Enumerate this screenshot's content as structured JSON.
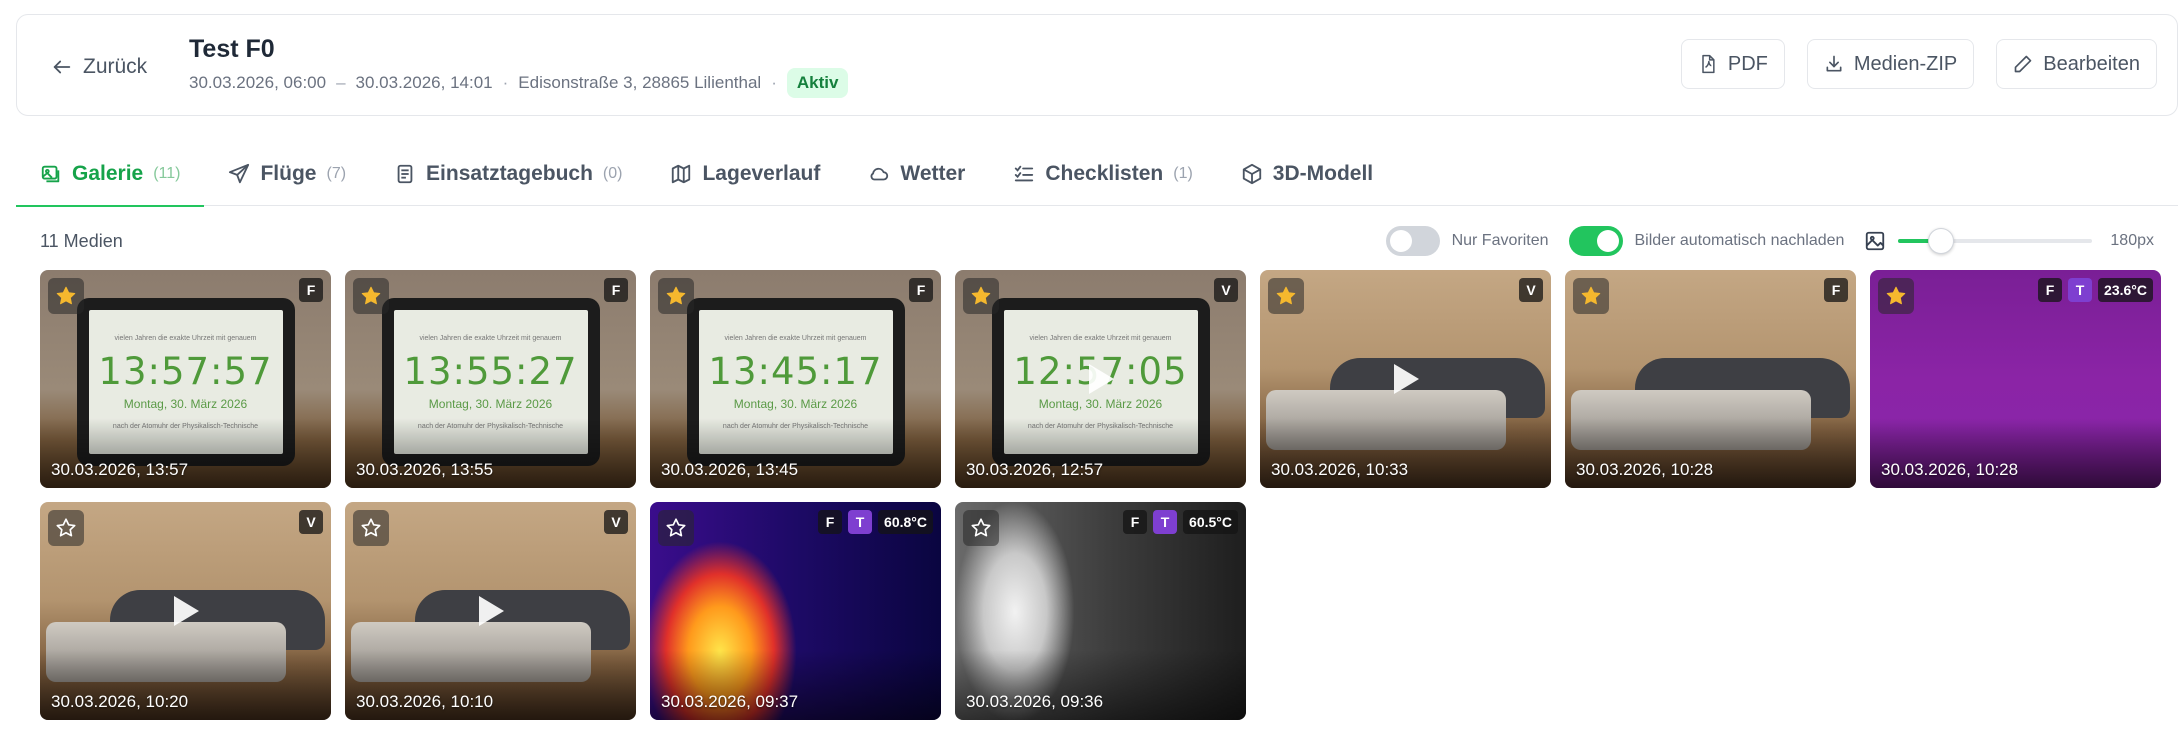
{
  "header": {
    "back_label": "Zurück",
    "title": "Test F0",
    "start": "30.03.2026, 06:00",
    "dash": "–",
    "end": "30.03.2026, 14:01",
    "dot": "·",
    "address": "Edisonstraße 3, 28865 Lilienthal",
    "status": "Aktiv",
    "buttons": {
      "pdf": "PDF",
      "zip": "Medien-ZIP",
      "edit": "Bearbeiten"
    }
  },
  "tabs": [
    {
      "label": "Galerie",
      "count": "(11)"
    },
    {
      "label": "Flüge",
      "count": "(7)"
    },
    {
      "label": "Einsatztagebuch",
      "count": "(0)"
    },
    {
      "label": "Lageverlauf",
      "count": ""
    },
    {
      "label": "Wetter",
      "count": ""
    },
    {
      "label": "Checklisten",
      "count": "(1)"
    },
    {
      "label": "3D-Modell",
      "count": ""
    }
  ],
  "toolbar": {
    "media_count": "11 Medien",
    "favorites_label": "Nur Favoriten",
    "autoreload_label": "Bilder automatisch nachladen",
    "size_label": "180px",
    "size_fraction": 0.22
  },
  "clock": {
    "top_line": "vielen Jahren die exakte Uhrzeit mit genauem",
    "date_line": "Montag, 30. März 2026",
    "bottom_line": "nach der Atomuhr der Physikalisch-Technische"
  },
  "media": [
    {
      "timestamp": "30.03.2026, 13:57",
      "favorite": true,
      "type": "F",
      "thermal": false,
      "temp": "",
      "clock": "13:57:57",
      "video": false,
      "scene": "clock"
    },
    {
      "timestamp": "30.03.2026, 13:55",
      "favorite": true,
      "type": "F",
      "thermal": false,
      "temp": "",
      "clock": "13:55:27",
      "video": false,
      "scene": "clock"
    },
    {
      "timestamp": "30.03.2026, 13:45",
      "favorite": true,
      "type": "F",
      "thermal": false,
      "temp": "",
      "clock": "13:45:17",
      "video": false,
      "scene": "clock"
    },
    {
      "timestamp": "30.03.2026, 12:57",
      "favorite": true,
      "type": "V",
      "thermal": false,
      "temp": "",
      "clock": "12:57:05",
      "video": true,
      "scene": "clock"
    },
    {
      "timestamp": "30.03.2026, 10:33",
      "favorite": true,
      "type": "V",
      "thermal": false,
      "temp": "",
      "clock": "",
      "video": true,
      "scene": "desk"
    },
    {
      "timestamp": "30.03.2026, 10:28",
      "favorite": true,
      "type": "F",
      "thermal": false,
      "temp": "",
      "clock": "",
      "video": false,
      "scene": "desk"
    },
    {
      "timestamp": "30.03.2026, 10:28",
      "favorite": true,
      "type": "F",
      "thermal": true,
      "thermal_label": "T",
      "temp": "23.6°C",
      "clock": "",
      "video": false,
      "scene": "purple"
    },
    {
      "timestamp": "30.03.2026, 10:20",
      "favorite": false,
      "type": "V",
      "thermal": false,
      "temp": "",
      "clock": "",
      "video": true,
      "scene": "desk"
    },
    {
      "timestamp": "30.03.2026, 10:10",
      "favorite": false,
      "type": "V",
      "thermal": false,
      "temp": "",
      "clock": "",
      "video": true,
      "scene": "desk"
    },
    {
      "timestamp": "30.03.2026, 09:37",
      "favorite": false,
      "type": "F",
      "thermal": true,
      "thermal_label": "T",
      "temp": "60.8°C",
      "clock": "",
      "video": false,
      "scene": "ironbow"
    },
    {
      "timestamp": "30.03.2026, 09:36",
      "favorite": false,
      "type": "F",
      "thermal": true,
      "thermal_label": "T",
      "temp": "60.5°C",
      "clock": "",
      "video": false,
      "scene": "gray"
    }
  ],
  "colors": {
    "accent": "#22c55e",
    "active_tab": "#16a34a",
    "thermal_badge": "#7e3fd0",
    "star": "#f5b82e"
  }
}
